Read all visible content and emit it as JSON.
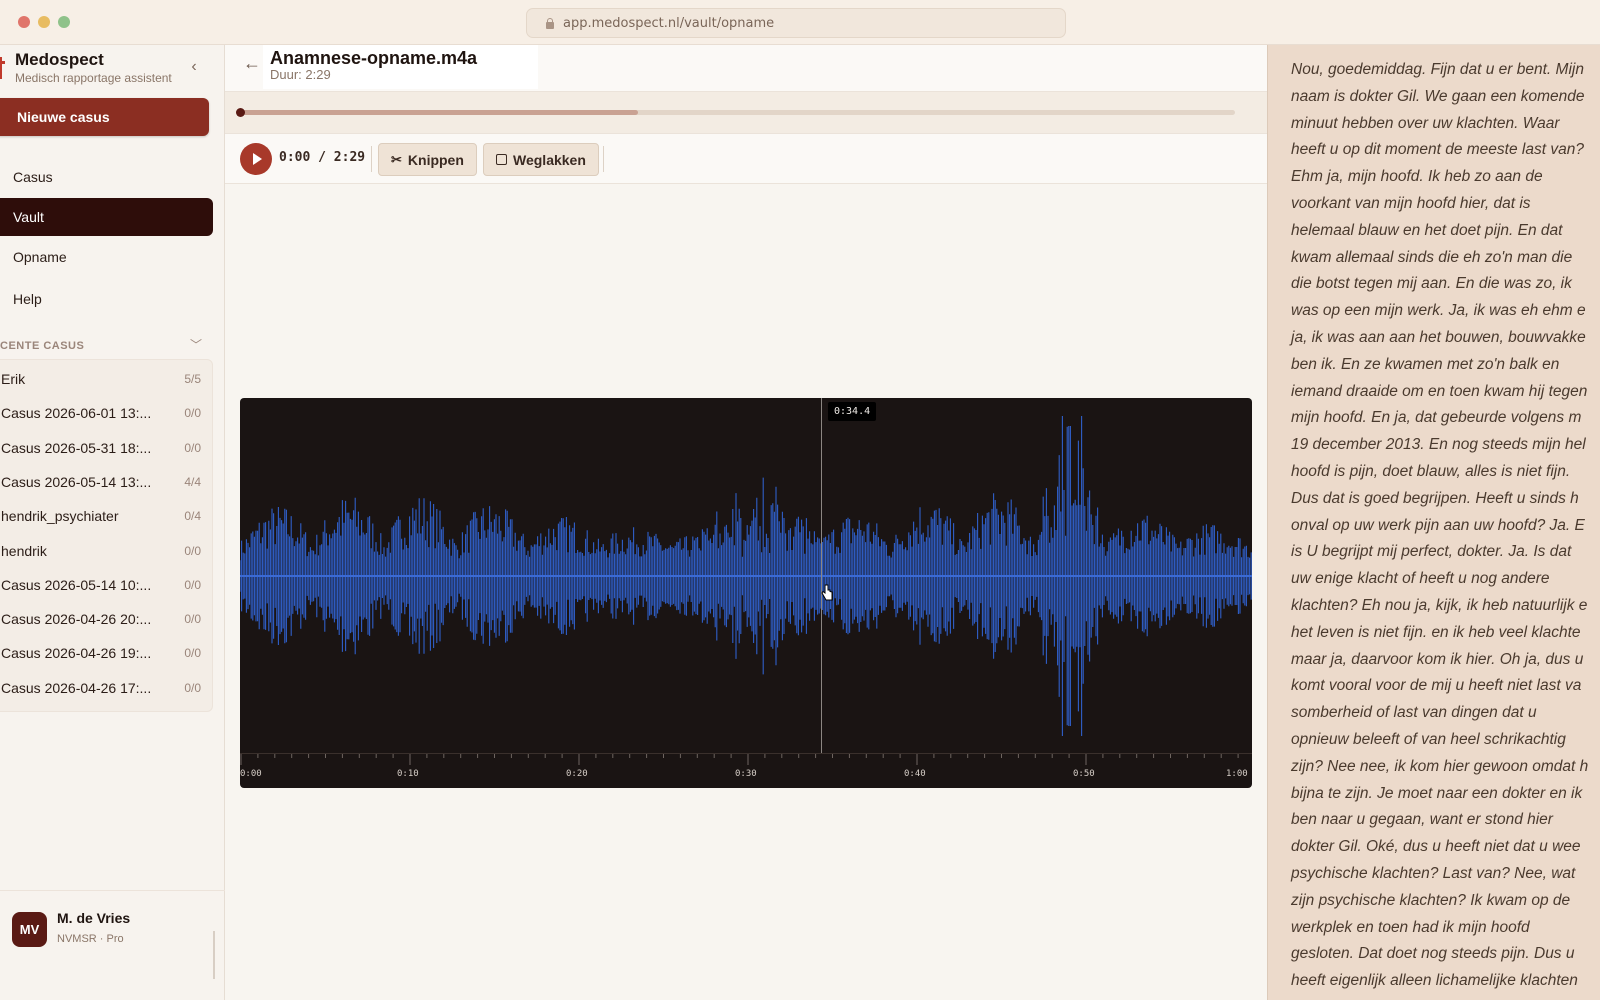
{
  "browser": {
    "url": "app.medospect.nl/vault/opname"
  },
  "sidebar": {
    "brand_name": "Medospect",
    "brand_subtitle": "Medisch rapportage assistent",
    "new_case_label": "Nieuwe casus",
    "nav": [
      {
        "label": "Casus",
        "active": false,
        "icon": "briefcase-icon"
      },
      {
        "label": "Vault",
        "active": true,
        "icon": "vault-icon"
      },
      {
        "label": "Opname",
        "active": false,
        "icon": "microphone-icon"
      },
      {
        "label": "Help",
        "active": false,
        "icon": "help-icon"
      }
    ],
    "recent_title": "CENTE CASUS",
    "recent_cases": [
      {
        "name": "Erik",
        "count": "5/5"
      },
      {
        "name": "Casus 2026-06-01 13:...",
        "count": "0/0"
      },
      {
        "name": "Casus 2026-05-31 18:...",
        "count": "0/0"
      },
      {
        "name": "Casus 2026-05-14 13:...",
        "count": "4/4"
      },
      {
        "name": "hendrik_psychiater",
        "count": "0/4"
      },
      {
        "name": "hendrik",
        "count": "0/0"
      },
      {
        "name": "Casus 2026-05-14 10:...",
        "count": "0/0"
      },
      {
        "name": "Casus 2026-04-26 20:...",
        "count": "0/0"
      },
      {
        "name": "Casus 2026-04-26 19:...",
        "count": "0/0"
      },
      {
        "name": "Casus 2026-04-26 17:...",
        "count": "0/0"
      }
    ],
    "user": {
      "initials": "MV",
      "name": "M. de Vries",
      "role": "NVMSR · Pro"
    }
  },
  "player": {
    "file_title": "Anamnese-opname.m4a",
    "duration_label": "Duur: 2:29",
    "timecode": "0:00 / 2:29",
    "progress_fraction": 0.4,
    "cut_label": "Knippen",
    "mask_label": "Weglakken",
    "cursor_time": "0:34.4",
    "timeline_ticks": [
      "0:00",
      "0:10",
      "0:20",
      "0:30",
      "0:40",
      "0:50",
      "1:00"
    ]
  },
  "colors": {
    "accent": "#8b2e22",
    "waveform": "#2f5fc9",
    "waveform_bg": "#1a1413",
    "transcript_bg": "#ecdacb"
  },
  "transcript": {
    "lines": [
      "Nou, goedemiddag. Fijn dat u er bent. Mijn",
      "naam is dokter Gil. We gaan een komende",
      "minuut hebben over uw klachten. Waar",
      "heeft u op dit moment de meeste last van?",
      "Ehm ja, mijn hoofd. Ik heb zo aan de",
      "voorkant van mijn hoofd hier, dat is",
      "helemaal blauw en het doet pijn. En dat",
      "kwam allemaal sinds die eh zo'n man die",
      "die botst tegen mij aan. En die was zo, ik",
      "was op een mijn werk. Ja, ik was eh ehm e",
      "ja, ik was aan aan het bouwen, bouwvakke",
      "ben ik. En ze kwamen met zo'n balk en",
      "iemand draaide om en toen kwam hij tegen",
      "mijn hoofd. En ja, dat gebeurde volgens m",
      "19 december 2013. En nog steeds mijn hel",
      "hoofd is pijn, doet blauw, alles is niet fijn.",
      "Dus dat is goed begrijpen. Heeft u sinds h",
      "onval op uw werk pijn aan uw hoofd? Ja. E",
      "is U begrijpt mij perfect, dokter. Ja. Is dat",
      "uw enige klacht of heeft u nog andere",
      "klachten? Eh nou ja, kijk, ik heb natuurlijk e",
      "het leven is niet fijn. en ik heb veel klachte",
      "maar ja, daarvoor kom ik hier. Oh ja, dus u",
      "komt vooral voor de mij u heeft niet last va",
      "somberheid of last van dingen dat u",
      "opnieuw beleeft of van heel schrikachtig",
      "zijn? Nee nee, ik kom hier gewoon omdat h",
      "bijna te zijn. Je moet naar een dokter en ik",
      "ben naar u gegaan, want er stond hier",
      "dokter Gil. Oké, dus u heeft niet dat u wee",
      "psychische klachten? Last van? Nee, wat",
      "zijn psychische klachten? Ik kwam op de",
      "werkplek en toen had ik mijn hoofd",
      "gesloten. Dat doet nog steeds pijn. Dus u",
      "heeft eigenlijk alleen lichamelijke klachten"
    ]
  }
}
